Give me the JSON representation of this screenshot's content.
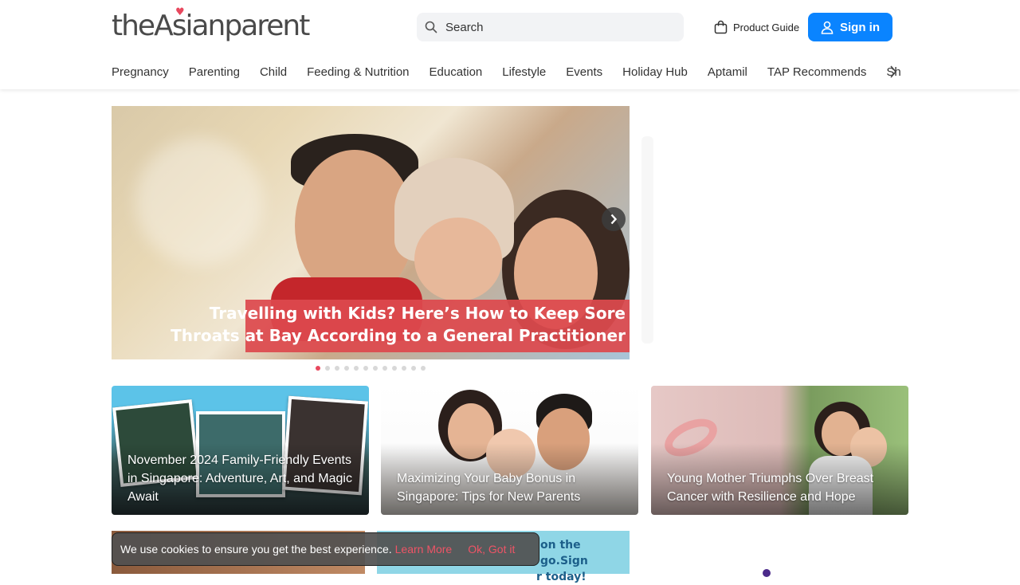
{
  "header": {
    "logo_text": "theAsianparent",
    "search_placeholder": "Search",
    "product_guide_label": "Product Guide",
    "signin_label": "Sign in"
  },
  "nav": {
    "items": [
      "Pregnancy",
      "Parenting",
      "Child",
      "Feeding & Nutrition",
      "Education",
      "Lifestyle",
      "Events",
      "Holiday Hub",
      "Aptamil",
      "TAP Recommends",
      "Shopping"
    ]
  },
  "hero": {
    "caption_line1": "Travelling with Kids? Here’s How to Keep Sore",
    "caption_line2": "Throats at Bay According to a General Practitioner",
    "slide_count": 12,
    "active_slide": 1
  },
  "cards": [
    {
      "title": "November 2024 Family-Friendly Events in Singapore: Adventure, Art, and Magic Await"
    },
    {
      "title": "Maximizing Your Baby Bonus in Singapore: Tips for New Parents"
    },
    {
      "title": "Young Mother Triumphs Over Breast Cancer with Resilience and Hope"
    }
  ],
  "promo": {
    "line1": "on the go.Sign",
    "line2": "r today!"
  },
  "cookie": {
    "message": "We use cookies to ensure you get the best experience.",
    "learn_more": "Learn More",
    "ok_label": "Ok, Got it"
  },
  "colors": {
    "accent_blue": "#0a84ff",
    "accent_red": "#e8485e",
    "caption_red": "#dd494d"
  }
}
